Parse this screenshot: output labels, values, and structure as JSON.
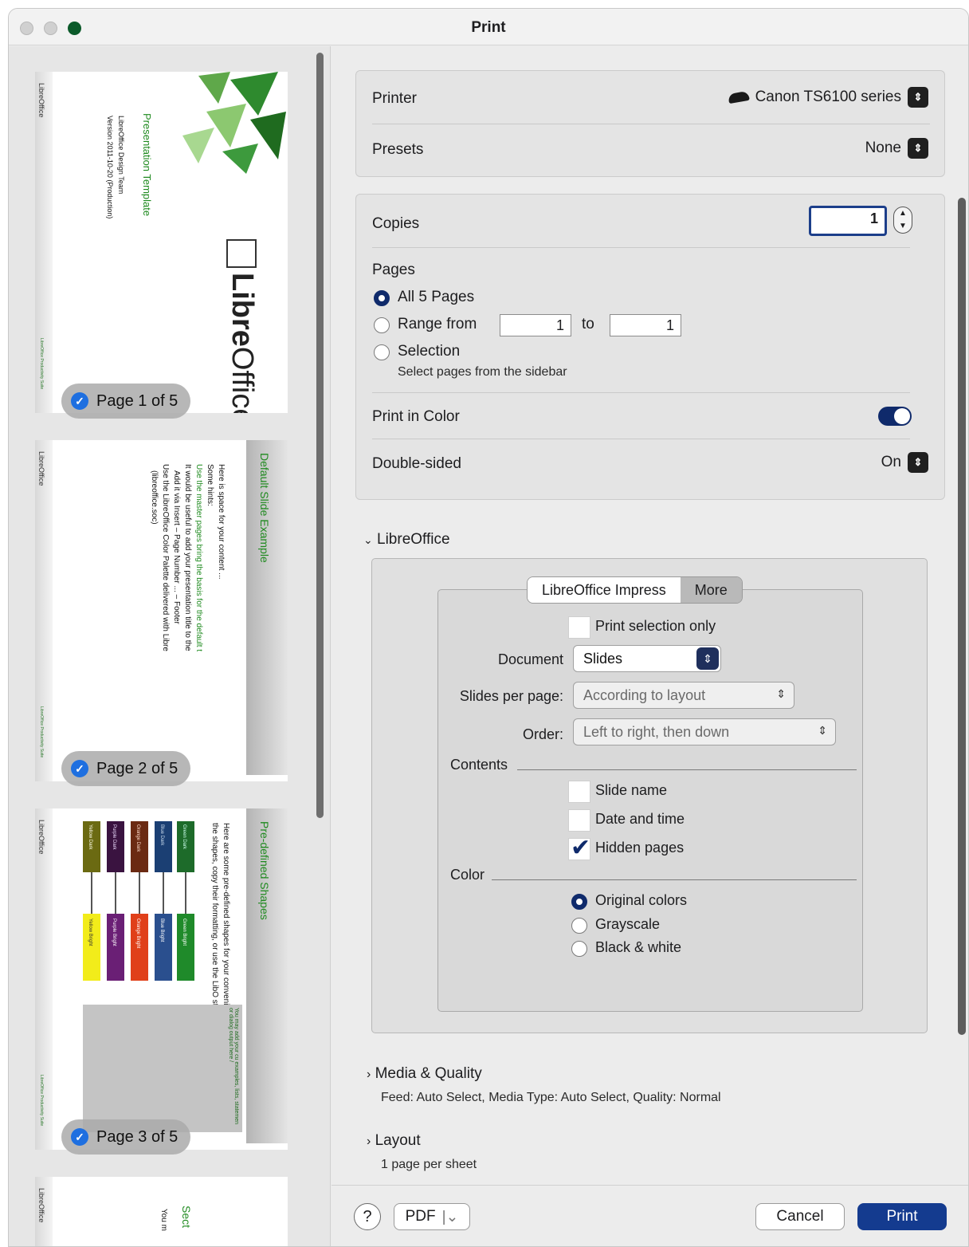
{
  "window": {
    "title": "Print"
  },
  "previews": [
    {
      "badge": "Page 1 of 5",
      "title": "Presentation Template",
      "bullets": [
        "LibreOffice Design Team",
        "Version 2011-10-20 (Production)"
      ],
      "brand_libre": "Libre",
      "brand_office": "Office",
      "logo": "LibreOffice"
    },
    {
      "badge": "Page 2 of 5",
      "title": "Default Slide Example",
      "bullets": [
        "Here is space for your content ...",
        "Some hints:",
        "Use the master pages bring the basis for the default t",
        "It would be useful to add your presentation title to the",
        "Add it via Insert – Page Number ... – Footer",
        "Use the LibreOffice Color Palette delivered with Libre",
        "(libreoffice.soc)"
      ],
      "logo": "LibreOffice"
    },
    {
      "badge": "Page 3 of 5",
      "title": "Pre-defined Shapes",
      "bullets": [
        "Here are some pre-defined shapes for your convenience co",
        "the shapes, copy their formatting, or use the LibO styles."
      ],
      "logo": "LibreOffice",
      "shapes": [
        {
          "label": "Green Dark",
          "color": "#1d6b2a"
        },
        {
          "label": "Blue Dark",
          "color": "#1b3f73"
        },
        {
          "label": "Orange Dark",
          "color": "#6b2a12"
        },
        {
          "label": "Purple Dark",
          "color": "#3a1340"
        },
        {
          "label": "Yellow Dark",
          "color": "#6b6a12"
        }
      ],
      "shapes_bright": [
        {
          "label": "Green Bright",
          "color": "#1f8a2a"
        },
        {
          "label": "Blue Bright",
          "color": "#2a4f8e"
        },
        {
          "label": "Orange Bright",
          "color": "#e0401a"
        },
        {
          "label": "Purple Bright",
          "color": "#6a1f75"
        },
        {
          "label": "Yellow Bright",
          "color": "#f2ec1a"
        }
      ],
      "callout": "You may add your cu examples, lists, statemen or dialog output here /"
    },
    {
      "title": "Sect",
      "body": "You m",
      "logo": "LibreOffice"
    }
  ],
  "printer": {
    "label": "Printer",
    "value": "Canon TS6100 series"
  },
  "presets": {
    "label": "Presets",
    "value": "None"
  },
  "copies": {
    "label": "Copies",
    "value": "1"
  },
  "pages": {
    "label": "Pages",
    "all": "All 5 Pages",
    "range": "Range from",
    "range_from": "1",
    "range_to_label": "to",
    "range_to": "1",
    "selection": "Selection",
    "selection_hint": "Select pages from the sidebar"
  },
  "print_in_color": {
    "label": "Print in Color",
    "on": true
  },
  "double_sided": {
    "label": "Double-sided",
    "value": "On"
  },
  "libreoffice_section": {
    "label": "LibreOffice",
    "tabs": [
      "LibreOffice Impress",
      "More"
    ],
    "print_selection_only": "Print selection only",
    "document_label": "Document",
    "document_value": "Slides",
    "slides_per_page_label": "Slides per page:",
    "slides_per_page_value": "According to layout",
    "order_label": "Order:",
    "order_value": "Left to right, then down",
    "contents_label": "Contents",
    "contents": [
      {
        "label": "Slide name",
        "checked": false
      },
      {
        "label": "Date and time",
        "checked": false
      },
      {
        "label": "Hidden pages",
        "checked": true
      }
    ],
    "color_label": "Color",
    "color_options": [
      "Original colors",
      "Grayscale",
      "Black & white"
    ]
  },
  "media_quality": {
    "label": "Media & Quality",
    "summary": "Feed: Auto Select, Media Type: Auto Select, Quality: Normal"
  },
  "layout": {
    "label": "Layout",
    "summary": "1 page per sheet"
  },
  "footer": {
    "help": "?",
    "pdf": "PDF",
    "cancel": "Cancel",
    "print": "Print"
  }
}
